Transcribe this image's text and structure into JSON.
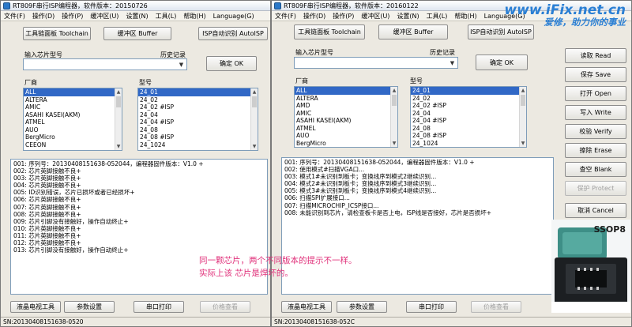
{
  "watermark": {
    "url": "www.iFix.net.cn",
    "slogan": "爱修，助力你的事业"
  },
  "chip_label": "SSOP8",
  "note_lines": [
    "同一颗芯片，两个不同版本的提示不一样。",
    "实际上该 芯片是焊坏的。"
  ],
  "left": {
    "title": "RT809F串行ISP编程器，软件版本：20150726",
    "menu": [
      "文件(F)",
      "操作(D)",
      "操作(P)",
      "缓冲区(U)",
      "设置(N)",
      "工具(L)",
      "帮助(H)",
      "Language(G)"
    ],
    "tabs": [
      "工具链面板 Toolchain",
      "缓冲区 Buffer",
      "ISP自动识别 AutoISP"
    ],
    "chip_input_label": "输入芯片型号",
    "history_label": "历史记录",
    "ok_label": "确定 OK",
    "vendor_label": "厂商",
    "model_label": "型号",
    "vendors": [
      "ALL",
      "ALTERA",
      "AMIC",
      "ASAHI KASEI(AKM)",
      "ATMEL",
      "AUO",
      "BergMicro",
      "CEEON"
    ],
    "models": [
      "24_01",
      "24_02",
      "24_02 #ISP",
      "24_04",
      "24_04 #ISP",
      "24_08",
      "24_08 #ISP",
      "24_1024"
    ],
    "log": [
      "001:  序列号：20130408151638-052044，编程器固件版本：V1.0 +",
      "002:  芯片英脚接触不良+",
      "003:  芯片英脚接触不良+",
      "004:  芯片英脚接触不良+",
      "005:  ID识别错误，芯片已损坏或者已经损坏+",
      "006:  芯片英脚接触不良+",
      "007:  芯片英脚接触不良+",
      "008:  芯片英脚接触不良+",
      "009:  芯片引脚没有接触好，操作自动终止+",
      "010:  芯片英脚接触不良+",
      "011:  芯片英脚接触不良+",
      "012:  芯片英脚接触不良+",
      "013:  芯片引脚没有接触好，操作自动终止+"
    ],
    "bottom_buttons": [
      "液晶电视工具",
      "参数设置",
      "串口打印",
      "价格查看"
    ],
    "status": "SN:20130408151638-0520"
  },
  "right": {
    "title": "RT809F串行ISP编程器，软件版本：20160122",
    "menu": [
      "文件(F)",
      "操作(D)",
      "操作(P)",
      "缓冲区(U)",
      "设置(N)",
      "工具(L)",
      "帮助(H)",
      "Language(G)"
    ],
    "tabs": [
      "工具链面板 Toolchain",
      "缓冲区 Buffer",
      "ISP自动识别 AutoISP"
    ],
    "chip_input_label": "输入芯片型号",
    "history_label": "历史记录",
    "ok_label": "确定 OK",
    "vendor_label": "厂商",
    "model_label": "型号",
    "vendors": [
      "ALL",
      "ALTERA",
      "AMD",
      "AMIC",
      "ASAHI KASEI(AKM)",
      "ATMEL",
      "AUO",
      "BergMicro"
    ],
    "models": [
      "24_01",
      "24_02",
      "24_02 #ISP",
      "24_04",
      "24_04 #ISP",
      "24_08",
      "24_08 #ISP",
      "24_1024"
    ],
    "log": [
      "001:  序列号：20130408151638-052044，编程器固件版本：V1.0 +",
      "002:  使用模式#扫描VGA口...",
      "003:  模式1#未识别到板卡；变换线序到模式2继续识别...",
      "004:  模式2#未识别到板卡；变换线序到模式3继续识别...",
      "005:  模式3#未识别到板卡；变换线序到模式4继续识别...",
      "006:  扫描SPI扩展接口...",
      "007:  扫描MICROCHIP_ICSP接口...",
      "008:  未能识别到芯片，请检查板卡是否上电，ISP线是否接好，芯片是否损坏+"
    ],
    "side_buttons": [
      "读取 Read",
      "保存 Save",
      "打开 Open",
      "写入 Write",
      "校验 Verify",
      "擦除 Erase",
      "查空 Blank",
      "保护 Protect",
      "取消 Cancel"
    ],
    "bottom_buttons": [
      "液晶电视工具",
      "参数设置",
      "串口打印",
      "价格查看"
    ],
    "status": "SN:20130408151638-052C"
  }
}
